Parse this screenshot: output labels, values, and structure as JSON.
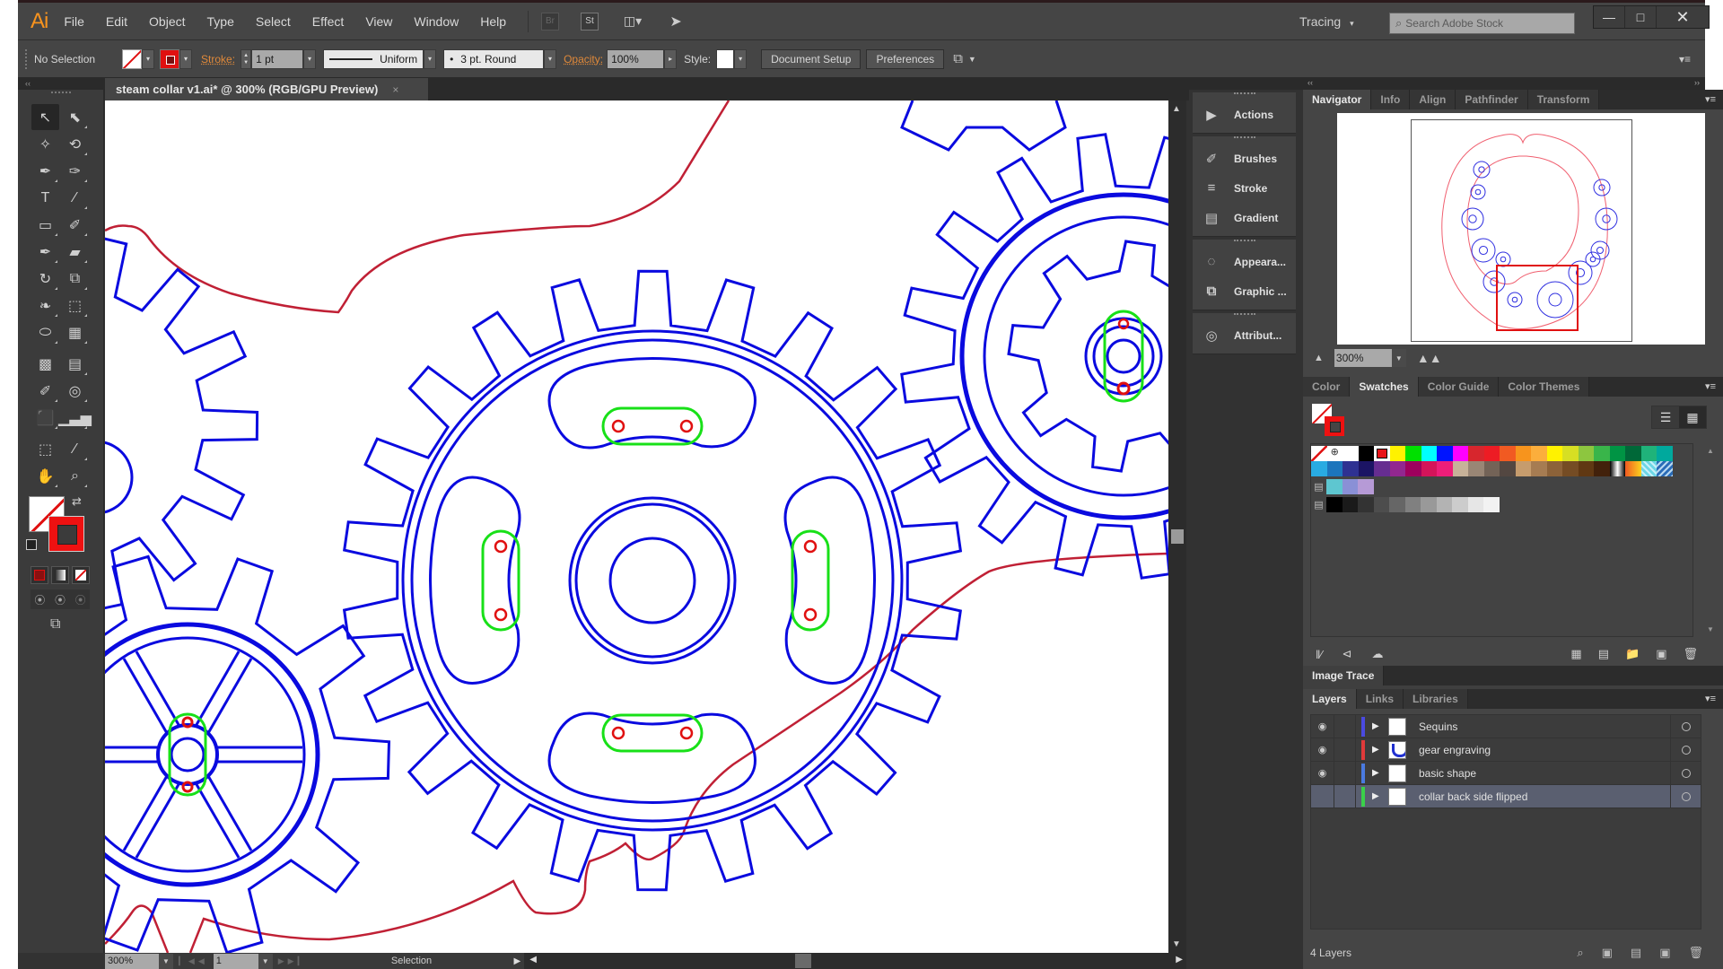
{
  "app": {
    "logo": "Ai",
    "menu": [
      "File",
      "Edit",
      "Object",
      "Type",
      "Select",
      "Effect",
      "View",
      "Window",
      "Help"
    ],
    "bridge_icon": "Br",
    "stock_icon": "St",
    "workspace": "Tracing",
    "search_placeholder": "Search Adobe Stock",
    "window_buttons": {
      "minimize": "—",
      "maximize": "□",
      "close": "✕"
    }
  },
  "control_bar": {
    "selection_label": "No Selection",
    "stroke_label": "Stroke:",
    "stroke_weight": "1 pt",
    "stroke_profile": "Uniform",
    "brush": "3 pt. Round",
    "opacity_label": "Opacity:",
    "opacity_value": "100%",
    "style_label": "Style:",
    "document_setup": "Document Setup",
    "preferences": "Preferences"
  },
  "document": {
    "tab_title": "steam collar v1.ai* @ 300% (RGB/GPU Preview)",
    "close": "×"
  },
  "toolbar": {
    "tools": [
      {
        "name": "selection-tool",
        "glyph": "↖"
      },
      {
        "name": "direct-selection-tool",
        "glyph": "⬉"
      },
      {
        "name": "magic-wand-tool",
        "glyph": "✧"
      },
      {
        "name": "lasso-tool",
        "glyph": "⟲"
      },
      {
        "name": "pen-tool",
        "glyph": "✒"
      },
      {
        "name": "curvature-tool",
        "glyph": "✑"
      },
      {
        "name": "type-tool",
        "glyph": "T"
      },
      {
        "name": "line-tool",
        "glyph": "∕"
      },
      {
        "name": "rectangle-tool",
        "glyph": "▭"
      },
      {
        "name": "paintbrush-tool",
        "glyph": "✐"
      },
      {
        "name": "shaper-tool",
        "glyph": "✒"
      },
      {
        "name": "eraser-tool",
        "glyph": "▰"
      },
      {
        "name": "rotate-tool",
        "glyph": "↻"
      },
      {
        "name": "scale-tool",
        "glyph": "⧉"
      },
      {
        "name": "width-tool",
        "glyph": "❧"
      },
      {
        "name": "free-transform-tool",
        "glyph": "⬚"
      },
      {
        "name": "shape-builder-tool",
        "glyph": "⬭"
      },
      {
        "name": "perspective-grid-tool",
        "glyph": "▦"
      },
      {
        "name": "mesh-tool",
        "glyph": "▩"
      },
      {
        "name": "gradient-tool",
        "glyph": "▤"
      },
      {
        "name": "eyedropper-tool",
        "glyph": "✐"
      },
      {
        "name": "blend-tool",
        "glyph": "◎"
      },
      {
        "name": "symbol-sprayer-tool",
        "glyph": "⬛"
      },
      {
        "name": "column-graph-tool",
        "glyph": "▁▃▅"
      },
      {
        "name": "artboard-tool",
        "glyph": "⬚"
      },
      {
        "name": "slice-tool",
        "glyph": "∕"
      },
      {
        "name": "hand-tool",
        "glyph": "✋"
      },
      {
        "name": "zoom-tool",
        "glyph": "⌕"
      }
    ],
    "swap_glyph": "⇄"
  },
  "dock": {
    "groups": [
      [
        {
          "label": "Actions",
          "glyph": "▶"
        }
      ],
      [
        {
          "label": "Brushes",
          "glyph": "✐"
        },
        {
          "label": "Stroke",
          "glyph": "≡"
        },
        {
          "label": "Gradient",
          "glyph": "▤"
        }
      ],
      [
        {
          "label": "Appeara...",
          "glyph": "◌"
        },
        {
          "label": "Graphic ...",
          "glyph": "⧉"
        }
      ],
      [
        {
          "label": "Attribut...",
          "glyph": "◎"
        }
      ]
    ]
  },
  "navigator": {
    "tabs": [
      "Navigator",
      "Info",
      "Align",
      "Pathfinder",
      "Transform"
    ],
    "active": "Navigator",
    "zoom": "300%"
  },
  "swatches": {
    "tabs": [
      "Color",
      "Swatches",
      "Color Guide",
      "Color Themes"
    ],
    "active": "Swatches",
    "row1": [
      "none",
      "registration",
      "#ffffff",
      "#000000",
      "#e8141a",
      "#fff200",
      "#00e000",
      "#00ffff",
      "#0014ff",
      "#ff00ff",
      "#d7262d",
      "#ed1c24",
      "#f15a22",
      "#f7941d",
      "#fbae3c",
      "#fff200",
      "#d7df23",
      "#8dc63f",
      "#39b54a",
      "#009444",
      "#006838",
      "#1fb37a",
      "#00a99d"
    ],
    "row2": [
      "#29abe2",
      "#1c75bc",
      "#2e3192",
      "#1b1464",
      "#662d91",
      "#92278f",
      "#9e005d",
      "#d4145a",
      "#ed1e79",
      "#c7b299",
      "#998675",
      "#736357",
      "#534741",
      "#c69c6d",
      "#a67c52",
      "#8c6239",
      "#754c24",
      "#603813",
      "#42210b",
      "gradient-bw",
      "gradient-orange",
      "pattern-cyan",
      "pattern-blue"
    ],
    "group1": [
      "#5ec6d0",
      "#8a90d6",
      "#b69ad6"
    ],
    "group2": [
      "#000000",
      "#1a1a1a",
      "#333333",
      "#4d4d4d",
      "#666666",
      "#808080",
      "#999999",
      "#b3b3b3",
      "#cccccc",
      "#e6e6e6",
      "#f2f2f2"
    ]
  },
  "image_trace": {
    "title": "Image Trace"
  },
  "layers": {
    "tabs": [
      "Layers",
      "Links",
      "Libraries"
    ],
    "active": "Layers",
    "items": [
      {
        "name": "Sequins",
        "visible": true,
        "color": "#4a4ae0",
        "thumb": "plain",
        "selected": false
      },
      {
        "name": "gear engraving",
        "visible": true,
        "color": "#e03a3a",
        "thumb": "blue",
        "selected": false
      },
      {
        "name": "basic shape",
        "visible": true,
        "color": "#4a7ae0",
        "thumb": "plain",
        "selected": false
      },
      {
        "name": "collar back side flipped",
        "visible": false,
        "color": "#3ad04a",
        "thumb": "plain",
        "selected": true
      }
    ],
    "count": "4 Layers"
  },
  "status": {
    "zoom": "300%",
    "artboard": "1",
    "current_tool": "Selection"
  },
  "colors": {
    "gear_stroke": "#0a0adf",
    "collar_outline": "#c02035",
    "slot_green": "#18e018",
    "sequin_red": "#e01010",
    "ui_bg": "#454545"
  }
}
